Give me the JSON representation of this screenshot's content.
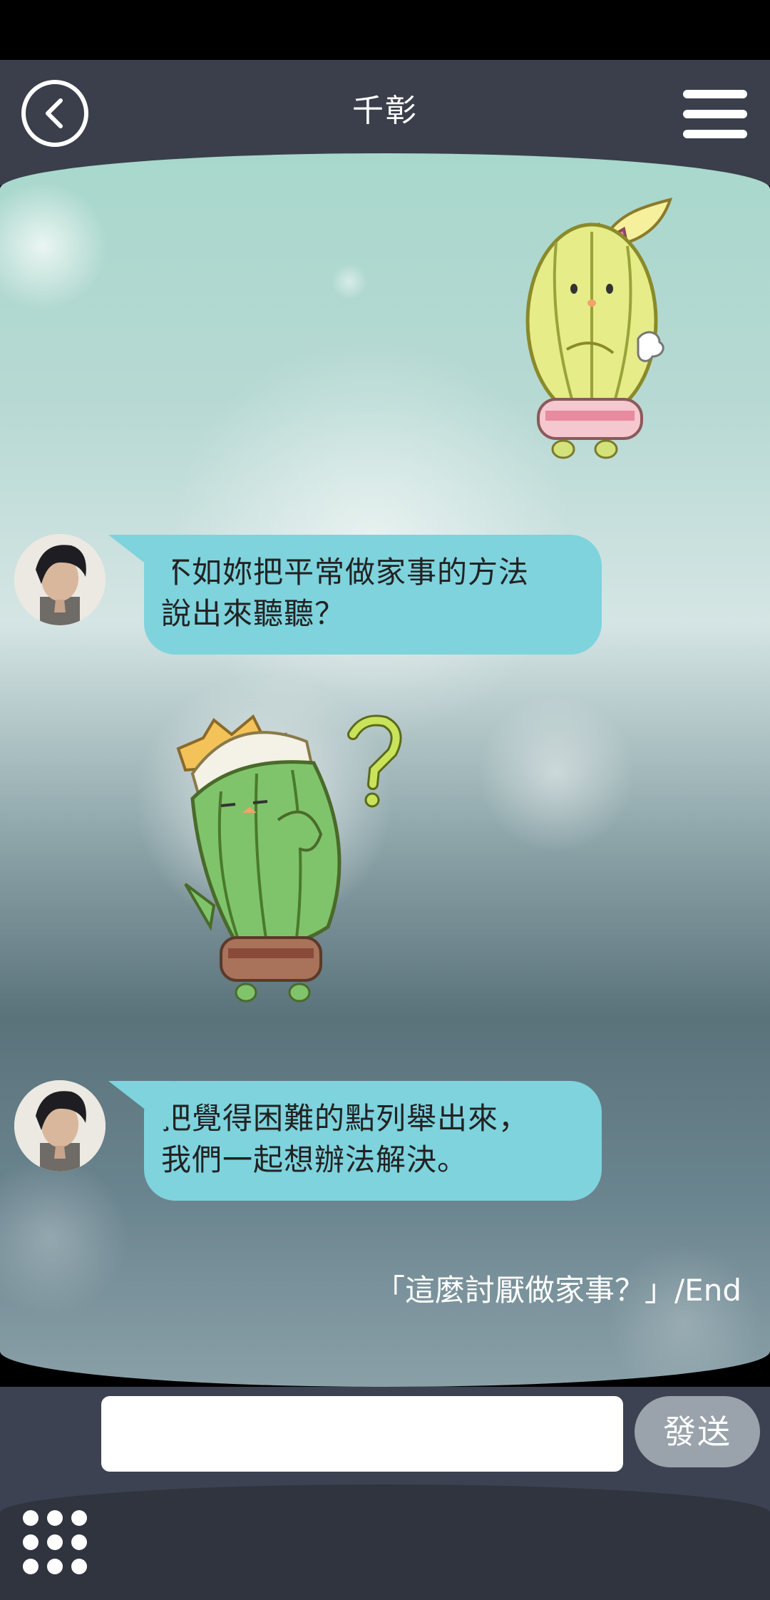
{
  "header": {
    "title": "千彰",
    "back_icon": "chevron-left-icon",
    "menu_icon": "hamburger-menu-icon"
  },
  "messages": [
    {
      "lines": [
        "不如妳把平常做家事的方法",
        "說出來聽聽？"
      ]
    },
    {
      "lines": [
        "把覺得困難的點列舉出來，",
        "我們一起想辦法解決。"
      ]
    }
  ],
  "end_text": "「這麼討厭做家事？」/End",
  "input": {
    "placeholder": "",
    "value": ""
  },
  "send_label": "發送",
  "colors": {
    "header_bg": "#3a3f4b",
    "bubble": "#7ed3dd",
    "send_button": "#9aa3ab",
    "input_bar": "#3c4251"
  },
  "icons": {
    "keyboard_grid": "grid-dots-icon",
    "sticker_1": "yellow-cactus-sticker",
    "sticker_2": "green-cactus-question-sticker"
  }
}
